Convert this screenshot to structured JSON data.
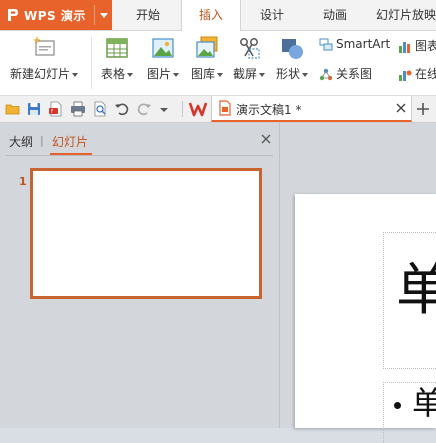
{
  "app": {
    "name": "WPS 演示"
  },
  "tabs": [
    "开始",
    "插入",
    "设计",
    "动画",
    "幻灯片放映"
  ],
  "active_tab": "插入",
  "ribbon": {
    "new_slide": "新建幻灯片",
    "table": "表格",
    "picture": "图片",
    "gallery": "图库",
    "screenshot": "截屏",
    "shape": "形状",
    "smartart": "SmartArt",
    "chart": "图表",
    "relation": "关系图",
    "online": "在线"
  },
  "document": {
    "tab_title": "演示文稿1 *"
  },
  "panel": {
    "tab_outline": "大纲",
    "divider": "|",
    "tab_slides": "幻灯片",
    "slide_number": "1"
  },
  "slide": {
    "title_partial": "单",
    "body_partial": "单"
  },
  "colors": {
    "accent": "#e8622b",
    "active_tab_text": "#c0531e",
    "thumb_border": "#c8642d"
  },
  "icons": [
    "wps-logo-icon",
    "new-slide-icon",
    "table-icon",
    "picture-icon",
    "gallery-icon",
    "screenshot-icon",
    "shape-icon",
    "smartart-icon",
    "chart-icon",
    "relation-icon",
    "online-icon",
    "open-folder-icon",
    "save-icon",
    "export-pdf-icon",
    "print-icon",
    "print-preview-icon",
    "undo-icon",
    "redo-icon",
    "customize-arrow-icon",
    "wps-brand-icon",
    "document-icon",
    "close-icon",
    "add-tab-icon",
    "panel-close-icon"
  ]
}
